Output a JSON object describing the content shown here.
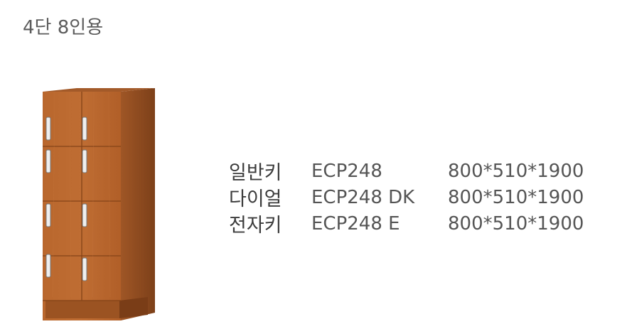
{
  "title": "4단 8인용",
  "image": {
    "subject": "locker-cabinet-illustration",
    "colors": {
      "wood_front": "#b7642a",
      "wood_side": "#9b5424",
      "wood_top": "#a25a28",
      "handle": "#e8e8e8"
    }
  },
  "specs": [
    {
      "type": "일반키",
      "model": "ECP248",
      "size": "800*510*1900"
    },
    {
      "type": "다이얼",
      "model": "ECP248 DK",
      "size": "800*510*1900"
    },
    {
      "type": "전자키",
      "model": "ECP248 E",
      "size": "800*510*1900"
    }
  ]
}
